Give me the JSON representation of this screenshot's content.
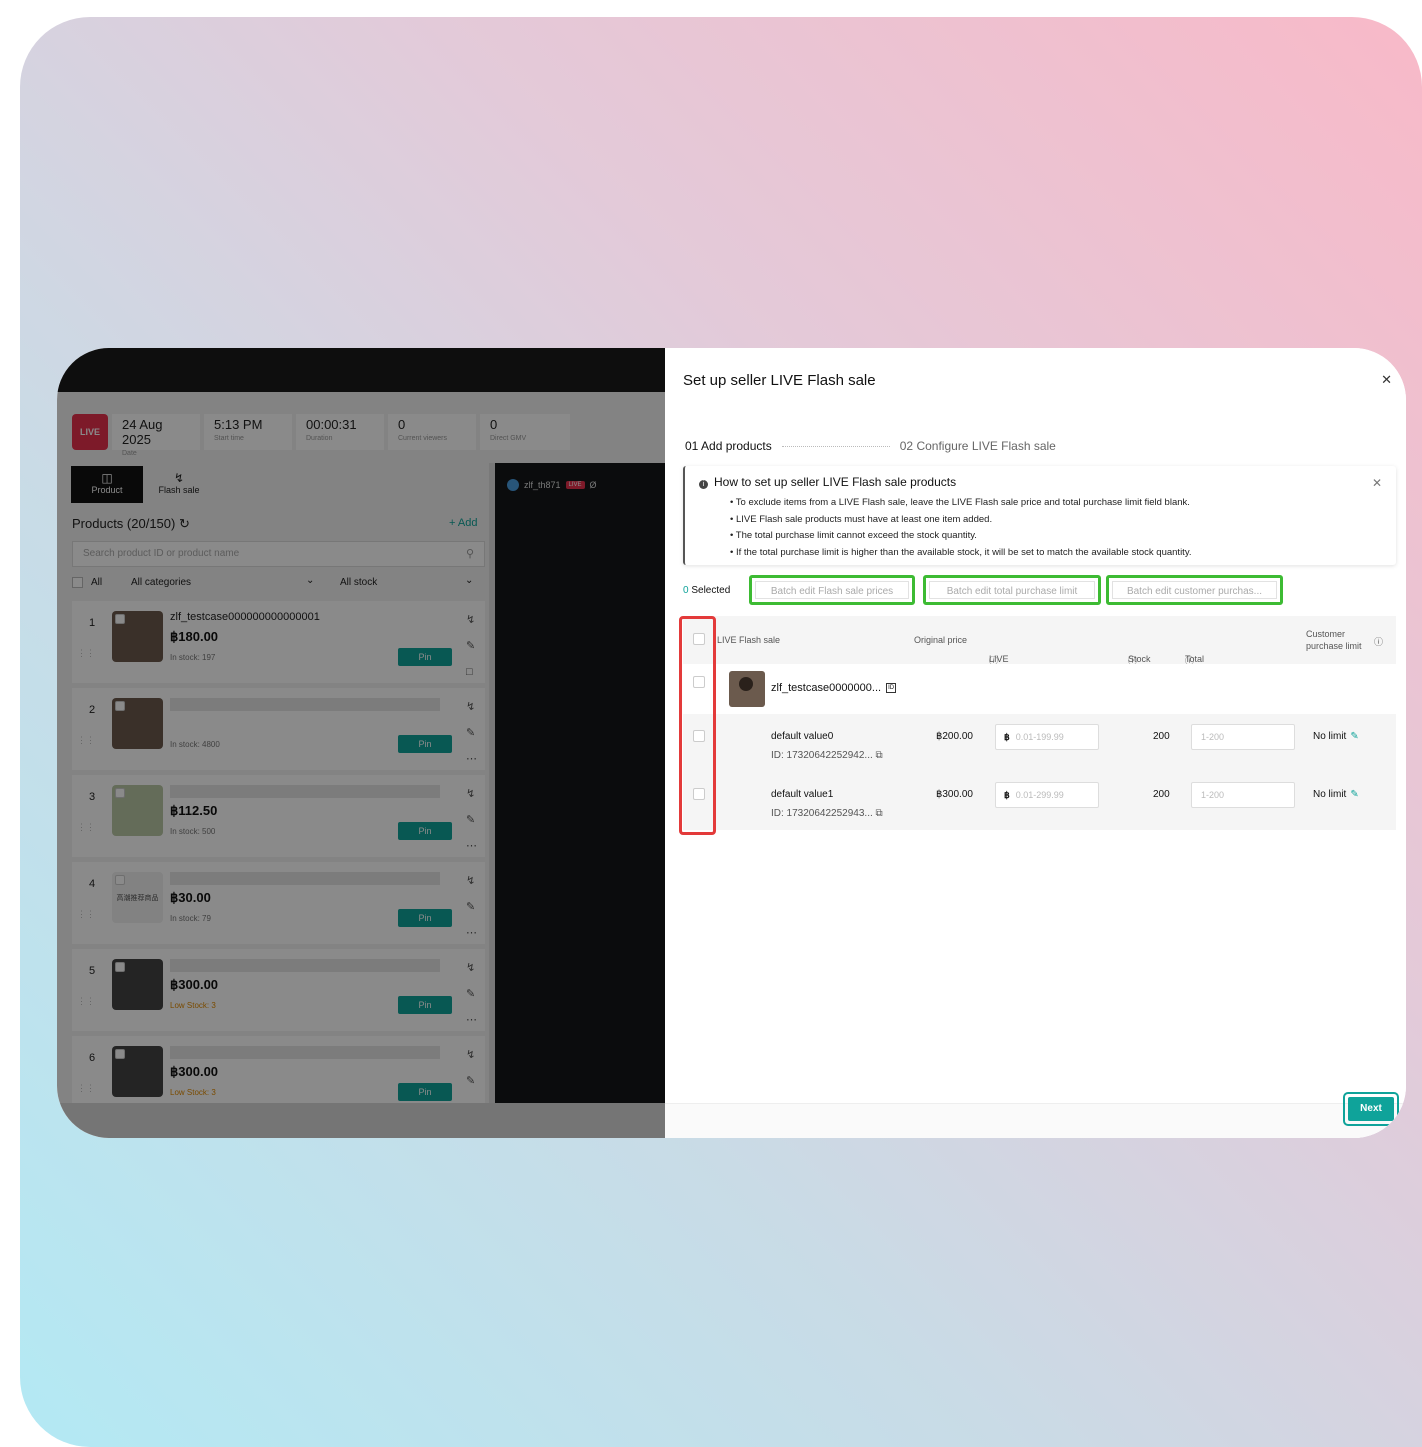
{
  "left": {
    "stats": [
      {
        "value": "24 Aug 2025",
        "label": "Date"
      },
      {
        "value": "5:13 PM",
        "label": "Start time"
      },
      {
        "value": "00:00:31",
        "label": "Duration"
      },
      {
        "value": "0",
        "label": "Current viewers"
      },
      {
        "value": "0",
        "label": "Direct GMV"
      }
    ],
    "logo": "LIVE",
    "tabs": [
      {
        "label": "Product"
      },
      {
        "label": "Flash sale"
      }
    ],
    "products_title": "Products (20/150)",
    "add_label": "+ Add",
    "search_placeholder": "Search product ID or product name",
    "filters": {
      "all": "All",
      "categories": "All categories",
      "stock": "All stock"
    },
    "pin_label": "Pin",
    "products": [
      {
        "num": "1",
        "name": "zlf_testcase000000000000001",
        "price": "฿180.00",
        "stock": "In stock: 197"
      },
      {
        "num": "2",
        "name": "",
        "price": "",
        "stock": "In stock: 4800"
      },
      {
        "num": "3",
        "name": "",
        "price": "฿112.50",
        "stock": "In stock: 500"
      },
      {
        "num": "4",
        "name": "",
        "price": "฿30.00",
        "stock": "In stock: 79",
        "thumb_text": "高潮推荐商品"
      },
      {
        "num": "5",
        "name": "",
        "price": "฿300.00",
        "stock": "Low Stock: 3"
      },
      {
        "num": "6",
        "name": "",
        "price": "฿300.00",
        "stock": "Low Stock: 3"
      }
    ],
    "video_user": "zlf_th871",
    "video_badge": "LIVE"
  },
  "modal": {
    "title": "Set up seller LIVE Flash sale",
    "steps": [
      {
        "num": "01",
        "label": "Add products"
      },
      {
        "num": "02",
        "label": "Configure LIVE Flash sale"
      }
    ],
    "info": {
      "title": "How to set up seller LIVE Flash sale products",
      "bullets": [
        "To exclude items from a LIVE Flash sale, leave the LIVE Flash sale price and total purchase limit field blank.",
        "LIVE Flash sale products must have at least one item added.",
        "The total purchase limit cannot exceed the stock quantity.",
        "If the total purchase limit is higher than the available stock, it will be set to match the available stock quantity."
      ]
    },
    "selected_count": "0",
    "selected_label": "Selected",
    "batch": [
      "Batch edit Flash sale prices",
      "Batch edit total purchase limit",
      "Batch edit customer purchas..."
    ],
    "columns": {
      "product": "LIVE Flash sale",
      "original_price": "Original price",
      "flash_price": "LIVE Flash sale price",
      "stock": "Stock",
      "total_limit": "Total purchase limit",
      "customer_limit": "Customer purchase limit"
    },
    "product": {
      "name": "zlf_testcase0000000..."
    },
    "variants": [
      {
        "name": "default value0",
        "id": "ID: 17320642252942...",
        "original": "฿200.00",
        "price_placeholder": "0.01-199.99",
        "stock": "200",
        "limit_placeholder": "1-200",
        "customer_limit": "No limit"
      },
      {
        "name": "default value1",
        "id": "ID: 17320642252943...",
        "original": "฿300.00",
        "price_placeholder": "0.01-299.99",
        "stock": "200",
        "limit_placeholder": "1-200",
        "customer_limit": "No limit"
      }
    ],
    "currency": "฿",
    "next_label": "Next"
  }
}
